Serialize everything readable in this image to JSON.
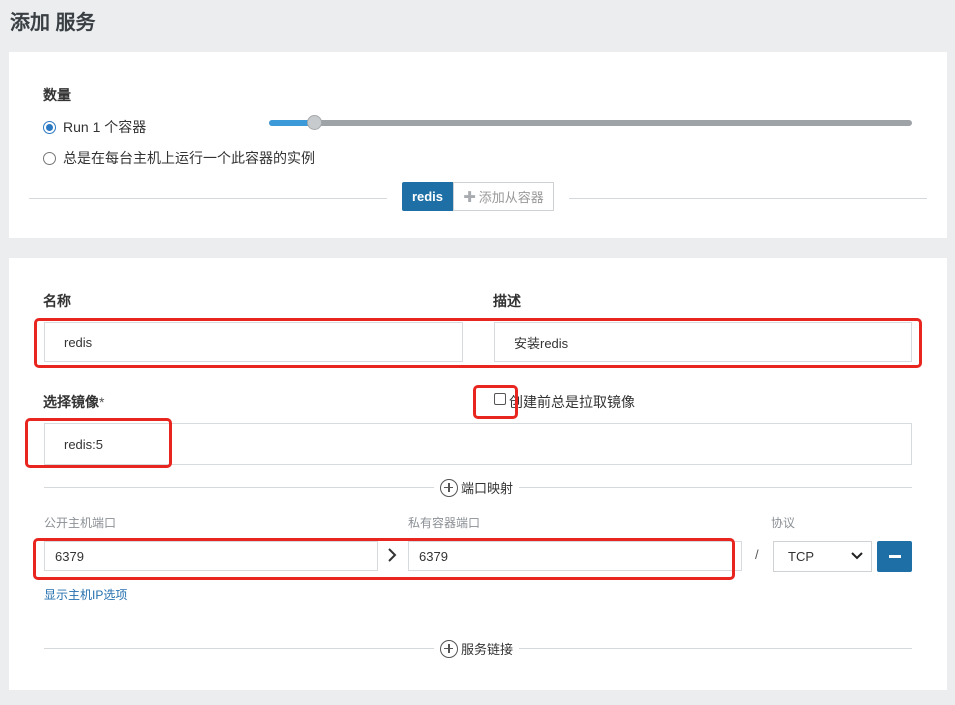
{
  "page": {
    "title": "添加 服务"
  },
  "scale": {
    "label": "数量",
    "run_option": "Run 1 个容器",
    "always_option": "总是在每台主机上运行一个此容器的实例",
    "slider_fraction": 0.07
  },
  "container_tabs": {
    "active": "redis",
    "add_label": "添加从容器"
  },
  "form": {
    "name_label": "名称",
    "name_value": "redis",
    "desc_label": "描述",
    "desc_value": "安装redis",
    "image_label": "选择镜像",
    "image_required": "*",
    "image_value": "redis:5",
    "always_pull_label": "创建前总是拉取镜像"
  },
  "ports": {
    "section_label": "端口映射",
    "public_label": "公开主机端口",
    "private_label": "私有容器端口",
    "protocol_label": "协议",
    "public_value": "6379",
    "private_value": "6379",
    "slash": "/",
    "protocol_value": "TCP",
    "show_host_ip": "显示主机IP选项"
  },
  "links": {
    "section_label": "服务链接"
  },
  "colors": {
    "primary": "#1d6fa5",
    "slider": "#3d9ad8",
    "highlight": "#e8251f"
  }
}
